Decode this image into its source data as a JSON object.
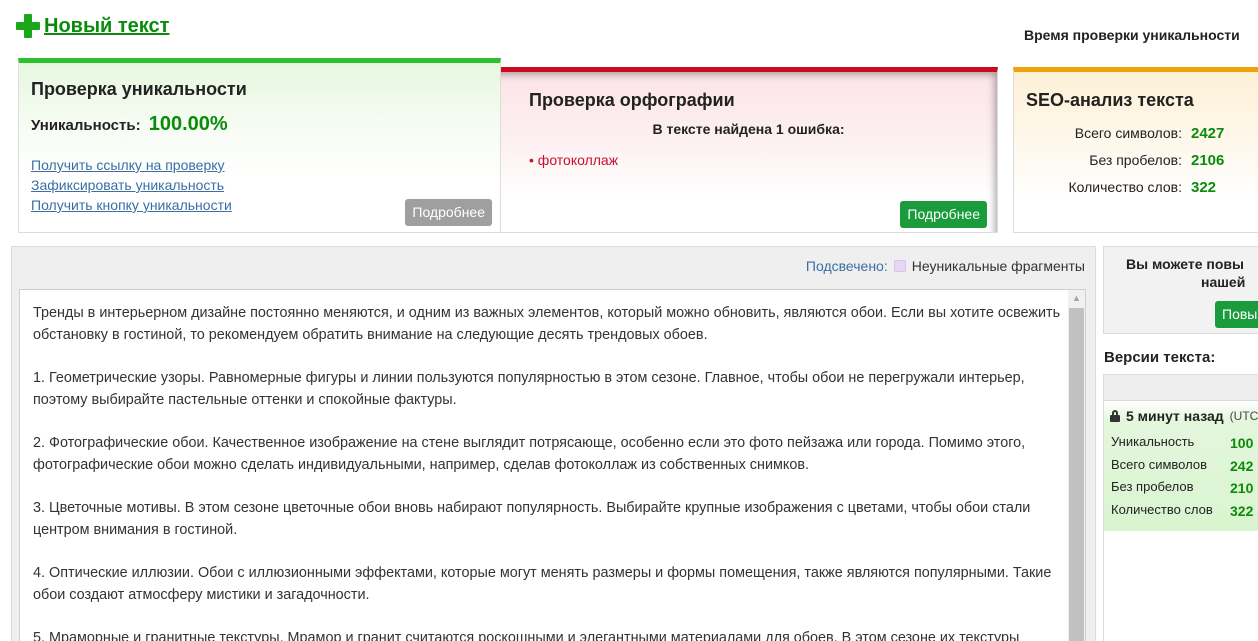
{
  "header": {
    "new_text_label": "Новый текст",
    "check_time_label": "Время проверки уникальности"
  },
  "uniqueness_card": {
    "title": "Проверка уникальности",
    "uniqueness_label": "Уникальность:",
    "uniqueness_value": "100.00%",
    "links": [
      "Получить ссылку на проверку",
      "Зафиксировать уникальность",
      "Получить кнопку уникальности"
    ],
    "more_button": "Подробнее"
  },
  "spelling_card": {
    "title": "Проверка орфографии",
    "found_text": "В тексте найдена 1 ошибка:",
    "errors": [
      "фотоколлаж"
    ],
    "more_button": "Подробнее"
  },
  "seo_card": {
    "title": "SEO-анализ текста",
    "rows": [
      {
        "label": "Всего символов:",
        "value": "2427"
      },
      {
        "label": "Без пробелов:",
        "value": "2106"
      },
      {
        "label": "Количество слов:",
        "value": "322"
      }
    ]
  },
  "editor": {
    "highlight_label": "Подсвечено:",
    "highlight_legend": "Неуникальные фрагменты",
    "paragraphs": [
      "Тренды в интерьерном дизайне постоянно меняются, и одним из важных элементов, который можно обновить, являются обои. Если вы хотите освежить обстановку в гостиной, то рекомендуем обратить внимание на следующие десять трендовых обоев.",
      "1. Геометрические узоры. Равномерные фигуры и линии пользуются популярностью в этом сезоне. Главное, чтобы обои не перегружали интерьер, поэтому выбирайте пастельные оттенки и спокойные фактуры.",
      "2. Фотографические обои. Качественное изображение на стене выглядит потрясающе, особенно если это фото пейзажа или города. Помимо этого, фотографические обои можно сделать индивидуальными, например, сделав фотоколлаж из собственных снимков.",
      "3. Цветочные мотивы. В этом сезоне цветочные обои вновь набирают популярность. Выбирайте крупные изображения с цветами, чтобы обои стали центром внимания в гостиной.",
      "4. Оптические иллюзии. Обои с иллюзионными эффектами, которые могут менять размеры и формы помещения, также являются популярными. Такие обои создают атмосферу мистики и загадочности.",
      "5. Мраморные и гранитные текстуры. Мрамор и гранит считаются роскошными и элегантными материалами для обоев. В этом сезоне их текстуры"
    ]
  },
  "sidebar": {
    "promo_line1": "Вы можете повы",
    "promo_line2": "нашей",
    "promo_button": "Повы",
    "versions_title": "Версии текста:",
    "version": {
      "time": "5 минут назад",
      "tz": "(UTC",
      "rows": [
        {
          "label": "Уникальность",
          "value": "100"
        },
        {
          "label": "Всего символов",
          "value": "242"
        },
        {
          "label": "Без пробелов",
          "value": "210"
        },
        {
          "label": "Количество слов",
          "value": "322"
        }
      ]
    }
  },
  "colors": {
    "green_accent": "#2dc02d",
    "red_accent": "#cc0a1e",
    "orange_accent": "#f0a20c",
    "value_green": "#0a8c0a",
    "link_blue": "#3b6ea5"
  }
}
